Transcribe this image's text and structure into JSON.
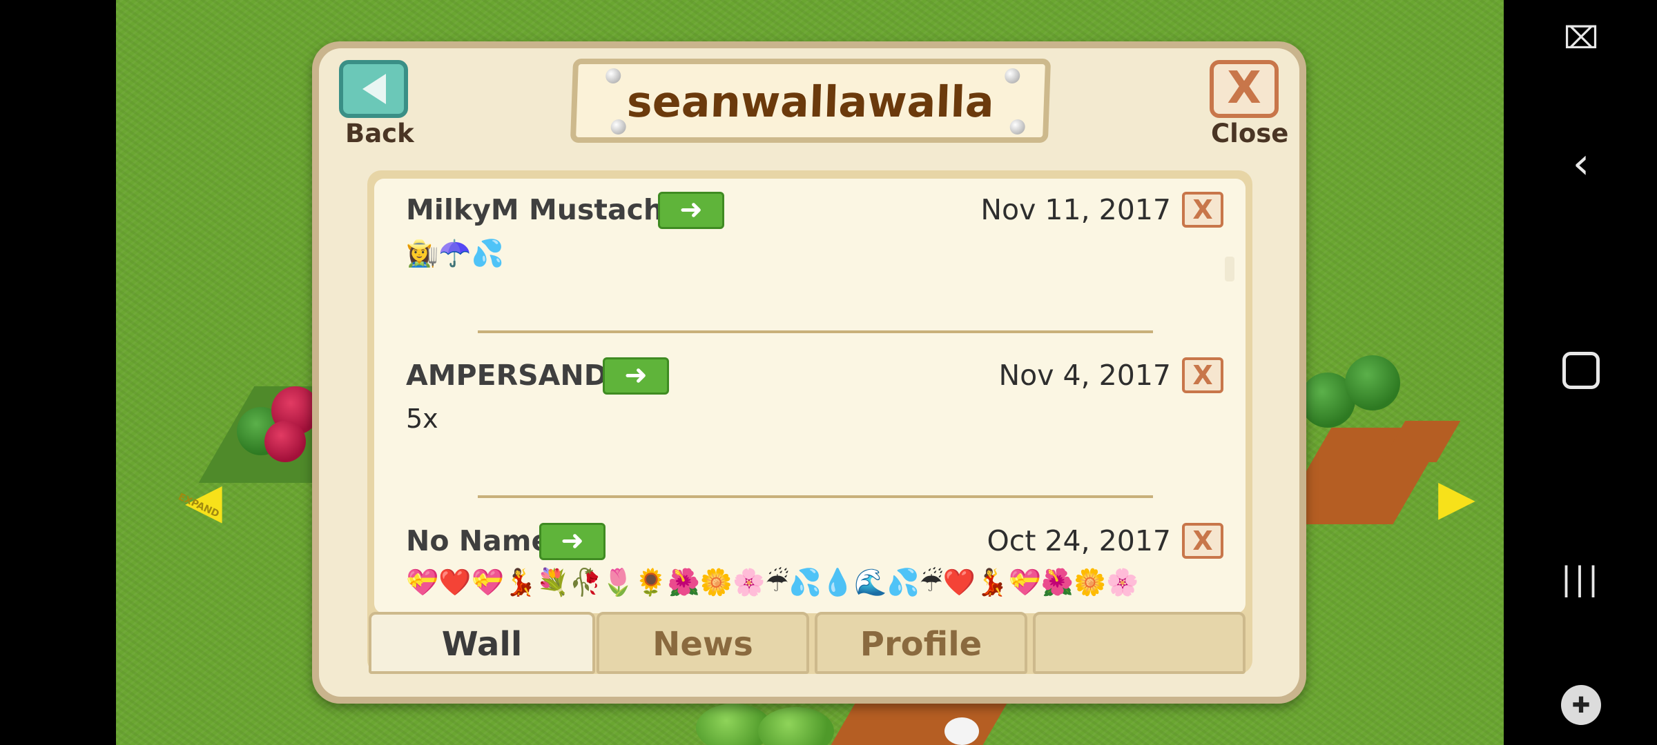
{
  "dialog": {
    "title": "seanwallawalla",
    "back_label": "Back",
    "close_label": "Close",
    "close_glyph": "X"
  },
  "posts": [
    {
      "author": "MilkyM Mustache",
      "date": "Nov 11, 2017",
      "message": "👩‍🌾☂️💦"
    },
    {
      "author": "AMPERSAND",
      "date": "Nov 4, 2017",
      "message": "5x"
    },
    {
      "author": "No Name",
      "date": "Oct 24, 2017",
      "message": "💝❤️💝💃💐🥀🌷🌻🌺🌼🌸☔💦💧🌊💦☔❤️💃💝🌺🌼🌸"
    }
  ],
  "post_icons": {
    "visit": "arrow-right-icon",
    "delete": "x-icon",
    "delete_glyph": "X",
    "visit_glyph": "➜"
  },
  "tabs": [
    {
      "label": "Wall",
      "active": true
    },
    {
      "label": "News",
      "active": false
    },
    {
      "label": "Profile",
      "active": false
    },
    {
      "label": "",
      "active": false
    }
  ],
  "farm": {
    "expand_label": "EXPAND"
  },
  "system_nav": {
    "icons": [
      "screen-touch-icon",
      "back-chevron-icon",
      "home-icon",
      "recents-icon",
      "game-controller-icon"
    ]
  },
  "colors": {
    "grass": "#6aa631",
    "dialog_frame": "#c9b48d",
    "parchment": "#f3ead0",
    "accent_green": "#5fb43a",
    "close_orange": "#c8764a",
    "title_brown": "#6b3a0c"
  }
}
